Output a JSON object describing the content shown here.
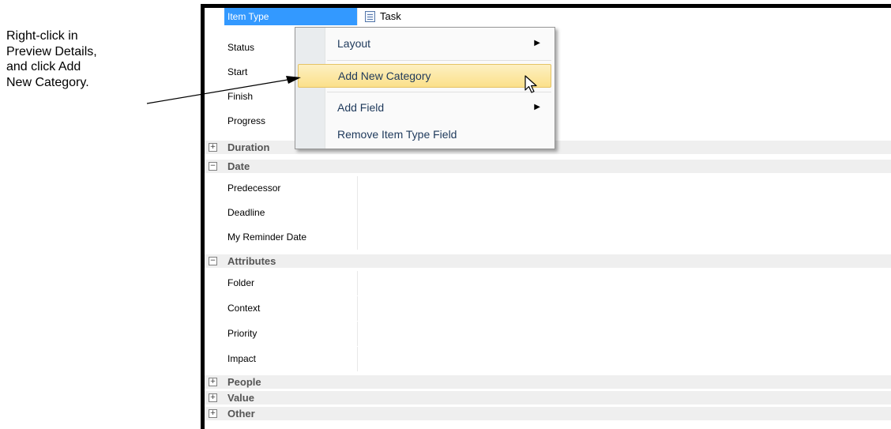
{
  "callout": {
    "lines": [
      "Right-click in",
      "Preview Details,",
      "and click Add",
      "New Category."
    ]
  },
  "item_type": {
    "label": "Item Type",
    "value": "Task",
    "icon": "task-icon"
  },
  "fields_top": [
    "Status",
    "Start",
    "Finish",
    "Progress"
  ],
  "categories": {
    "duration": {
      "label": "Duration",
      "toggle": "+"
    },
    "date": {
      "label": "Date",
      "toggle": "−",
      "fields": [
        "Predecessor",
        "Deadline",
        "My Reminder Date"
      ]
    },
    "attributes": {
      "label": "Attributes",
      "toggle": "−",
      "fields": [
        "Folder",
        "Context",
        "Priority",
        "Impact"
      ]
    },
    "people": {
      "label": "People",
      "toggle": "+"
    },
    "value": {
      "label": "Value",
      "toggle": "+"
    },
    "other": {
      "label": "Other",
      "toggle": "+"
    }
  },
  "context_menu": {
    "items": [
      {
        "label": "Layout",
        "submenu": "▶"
      },
      {
        "label": "Add New Category",
        "highlighted": true
      },
      {
        "label": "Add Field",
        "submenu": "▶"
      },
      {
        "label": "Remove Item Type Field"
      }
    ]
  },
  "colors": {
    "selection": "#3399ff",
    "menu_highlight": "#fbe08a",
    "menu_text": "#1e395b",
    "category_bg": "#efefef"
  }
}
